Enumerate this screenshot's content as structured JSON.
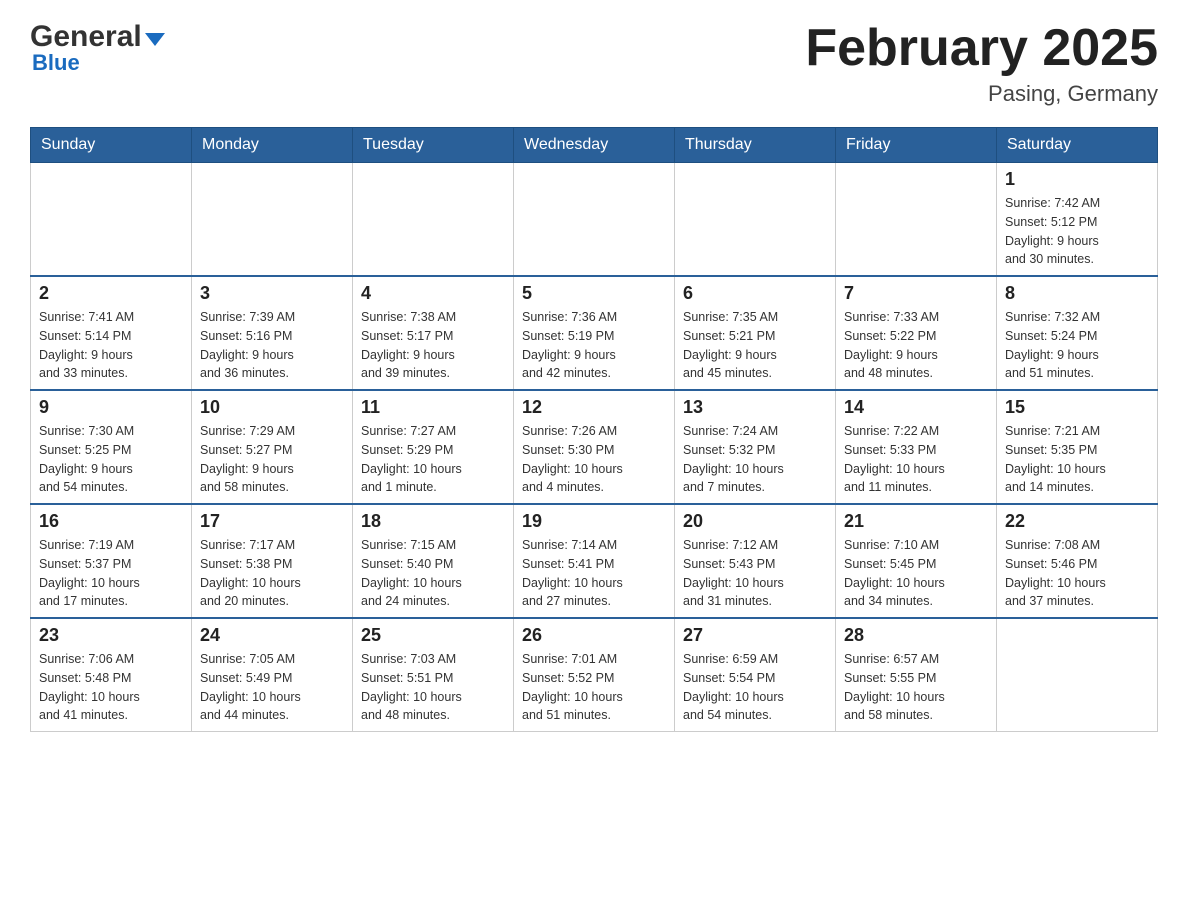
{
  "logo": {
    "general": "General",
    "arrow": "▼",
    "blue": "Blue"
  },
  "header": {
    "title": "February 2025",
    "location": "Pasing, Germany"
  },
  "weekdays": [
    "Sunday",
    "Monday",
    "Tuesday",
    "Wednesday",
    "Thursday",
    "Friday",
    "Saturday"
  ],
  "weeks": [
    [
      {
        "day": "",
        "info": ""
      },
      {
        "day": "",
        "info": ""
      },
      {
        "day": "",
        "info": ""
      },
      {
        "day": "",
        "info": ""
      },
      {
        "day": "",
        "info": ""
      },
      {
        "day": "",
        "info": ""
      },
      {
        "day": "1",
        "info": "Sunrise: 7:42 AM\nSunset: 5:12 PM\nDaylight: 9 hours\nand 30 minutes."
      }
    ],
    [
      {
        "day": "2",
        "info": "Sunrise: 7:41 AM\nSunset: 5:14 PM\nDaylight: 9 hours\nand 33 minutes."
      },
      {
        "day": "3",
        "info": "Sunrise: 7:39 AM\nSunset: 5:16 PM\nDaylight: 9 hours\nand 36 minutes."
      },
      {
        "day": "4",
        "info": "Sunrise: 7:38 AM\nSunset: 5:17 PM\nDaylight: 9 hours\nand 39 minutes."
      },
      {
        "day": "5",
        "info": "Sunrise: 7:36 AM\nSunset: 5:19 PM\nDaylight: 9 hours\nand 42 minutes."
      },
      {
        "day": "6",
        "info": "Sunrise: 7:35 AM\nSunset: 5:21 PM\nDaylight: 9 hours\nand 45 minutes."
      },
      {
        "day": "7",
        "info": "Sunrise: 7:33 AM\nSunset: 5:22 PM\nDaylight: 9 hours\nand 48 minutes."
      },
      {
        "day": "8",
        "info": "Sunrise: 7:32 AM\nSunset: 5:24 PM\nDaylight: 9 hours\nand 51 minutes."
      }
    ],
    [
      {
        "day": "9",
        "info": "Sunrise: 7:30 AM\nSunset: 5:25 PM\nDaylight: 9 hours\nand 54 minutes."
      },
      {
        "day": "10",
        "info": "Sunrise: 7:29 AM\nSunset: 5:27 PM\nDaylight: 9 hours\nand 58 minutes."
      },
      {
        "day": "11",
        "info": "Sunrise: 7:27 AM\nSunset: 5:29 PM\nDaylight: 10 hours\nand 1 minute."
      },
      {
        "day": "12",
        "info": "Sunrise: 7:26 AM\nSunset: 5:30 PM\nDaylight: 10 hours\nand 4 minutes."
      },
      {
        "day": "13",
        "info": "Sunrise: 7:24 AM\nSunset: 5:32 PM\nDaylight: 10 hours\nand 7 minutes."
      },
      {
        "day": "14",
        "info": "Sunrise: 7:22 AM\nSunset: 5:33 PM\nDaylight: 10 hours\nand 11 minutes."
      },
      {
        "day": "15",
        "info": "Sunrise: 7:21 AM\nSunset: 5:35 PM\nDaylight: 10 hours\nand 14 minutes."
      }
    ],
    [
      {
        "day": "16",
        "info": "Sunrise: 7:19 AM\nSunset: 5:37 PM\nDaylight: 10 hours\nand 17 minutes."
      },
      {
        "day": "17",
        "info": "Sunrise: 7:17 AM\nSunset: 5:38 PM\nDaylight: 10 hours\nand 20 minutes."
      },
      {
        "day": "18",
        "info": "Sunrise: 7:15 AM\nSunset: 5:40 PM\nDaylight: 10 hours\nand 24 minutes."
      },
      {
        "day": "19",
        "info": "Sunrise: 7:14 AM\nSunset: 5:41 PM\nDaylight: 10 hours\nand 27 minutes."
      },
      {
        "day": "20",
        "info": "Sunrise: 7:12 AM\nSunset: 5:43 PM\nDaylight: 10 hours\nand 31 minutes."
      },
      {
        "day": "21",
        "info": "Sunrise: 7:10 AM\nSunset: 5:45 PM\nDaylight: 10 hours\nand 34 minutes."
      },
      {
        "day": "22",
        "info": "Sunrise: 7:08 AM\nSunset: 5:46 PM\nDaylight: 10 hours\nand 37 minutes."
      }
    ],
    [
      {
        "day": "23",
        "info": "Sunrise: 7:06 AM\nSunset: 5:48 PM\nDaylight: 10 hours\nand 41 minutes."
      },
      {
        "day": "24",
        "info": "Sunrise: 7:05 AM\nSunset: 5:49 PM\nDaylight: 10 hours\nand 44 minutes."
      },
      {
        "day": "25",
        "info": "Sunrise: 7:03 AM\nSunset: 5:51 PM\nDaylight: 10 hours\nand 48 minutes."
      },
      {
        "day": "26",
        "info": "Sunrise: 7:01 AM\nSunset: 5:52 PM\nDaylight: 10 hours\nand 51 minutes."
      },
      {
        "day": "27",
        "info": "Sunrise: 6:59 AM\nSunset: 5:54 PM\nDaylight: 10 hours\nand 54 minutes."
      },
      {
        "day": "28",
        "info": "Sunrise: 6:57 AM\nSunset: 5:55 PM\nDaylight: 10 hours\nand 58 minutes."
      },
      {
        "day": "",
        "info": ""
      }
    ]
  ]
}
